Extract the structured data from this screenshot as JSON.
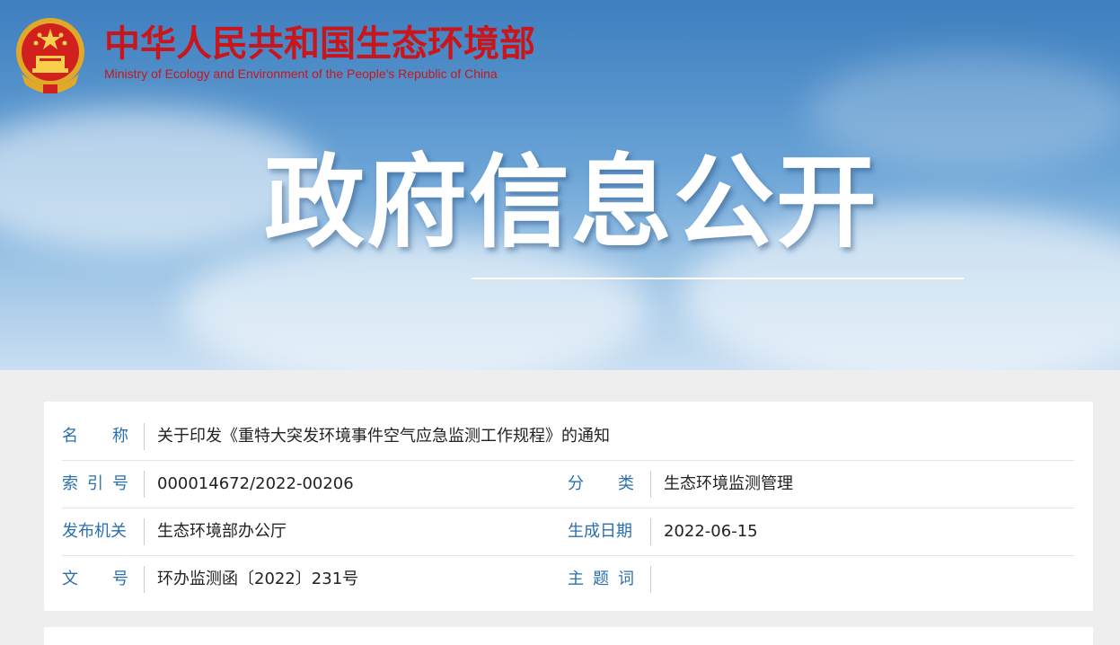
{
  "header": {
    "site_title": "中华人民共和国生态环境部",
    "site_subtitle": "Ministry of Ecology and Environment of the People's Republic of China",
    "hero_title": "政府信息公开"
  },
  "colors": {
    "brand_red": "#c8161d",
    "label_blue": "#2a6fb0",
    "sky_blue": "#4d8cc7"
  },
  "info": {
    "name_label": [
      "名",
      "称"
    ],
    "name_value": "关于印发《重特大突发环境事件空气应急监测工作规程》的通知",
    "index_label": [
      "索",
      "引",
      "号"
    ],
    "index_value": "000014672/2022-00206",
    "category_label": [
      "分",
      "类"
    ],
    "category_value": "生态环境监测管理",
    "issuer_label": [
      "发布机关"
    ],
    "issuer_value": "生态环境部办公厅",
    "date_label": [
      "生成日期"
    ],
    "date_value": "2022-06-15",
    "docno_label": [
      "文",
      "号"
    ],
    "docno_value": "环办监测函〔2022〕231号",
    "keywords_label": [
      "主",
      "题",
      "词"
    ],
    "keywords_value": ""
  }
}
